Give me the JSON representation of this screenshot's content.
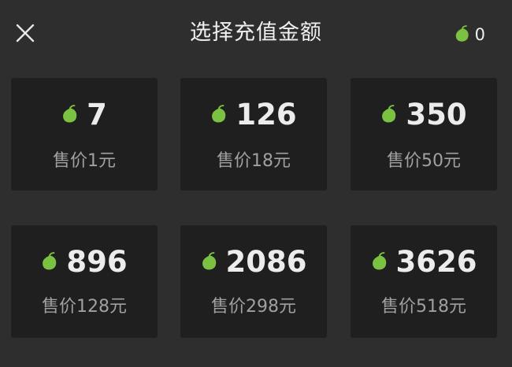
{
  "header": {
    "title": "选择充值金额",
    "balance": "0",
    "close_icon": "close-icon",
    "coin_icon": "green-leaf-coin-icon"
  },
  "colors": {
    "background": "#2e2e2e",
    "card": "#1f1f1f",
    "coin": "#7cc242",
    "text": "#ececec",
    "muted": "#a0a0a0"
  },
  "packages": [
    {
      "amount": "7",
      "price": "售价1元"
    },
    {
      "amount": "126",
      "price": "售价18元"
    },
    {
      "amount": "350",
      "price": "售价50元"
    },
    {
      "amount": "896",
      "price": "售价128元"
    },
    {
      "amount": "2086",
      "price": "售价298元"
    },
    {
      "amount": "3626",
      "price": "售价518元"
    }
  ]
}
